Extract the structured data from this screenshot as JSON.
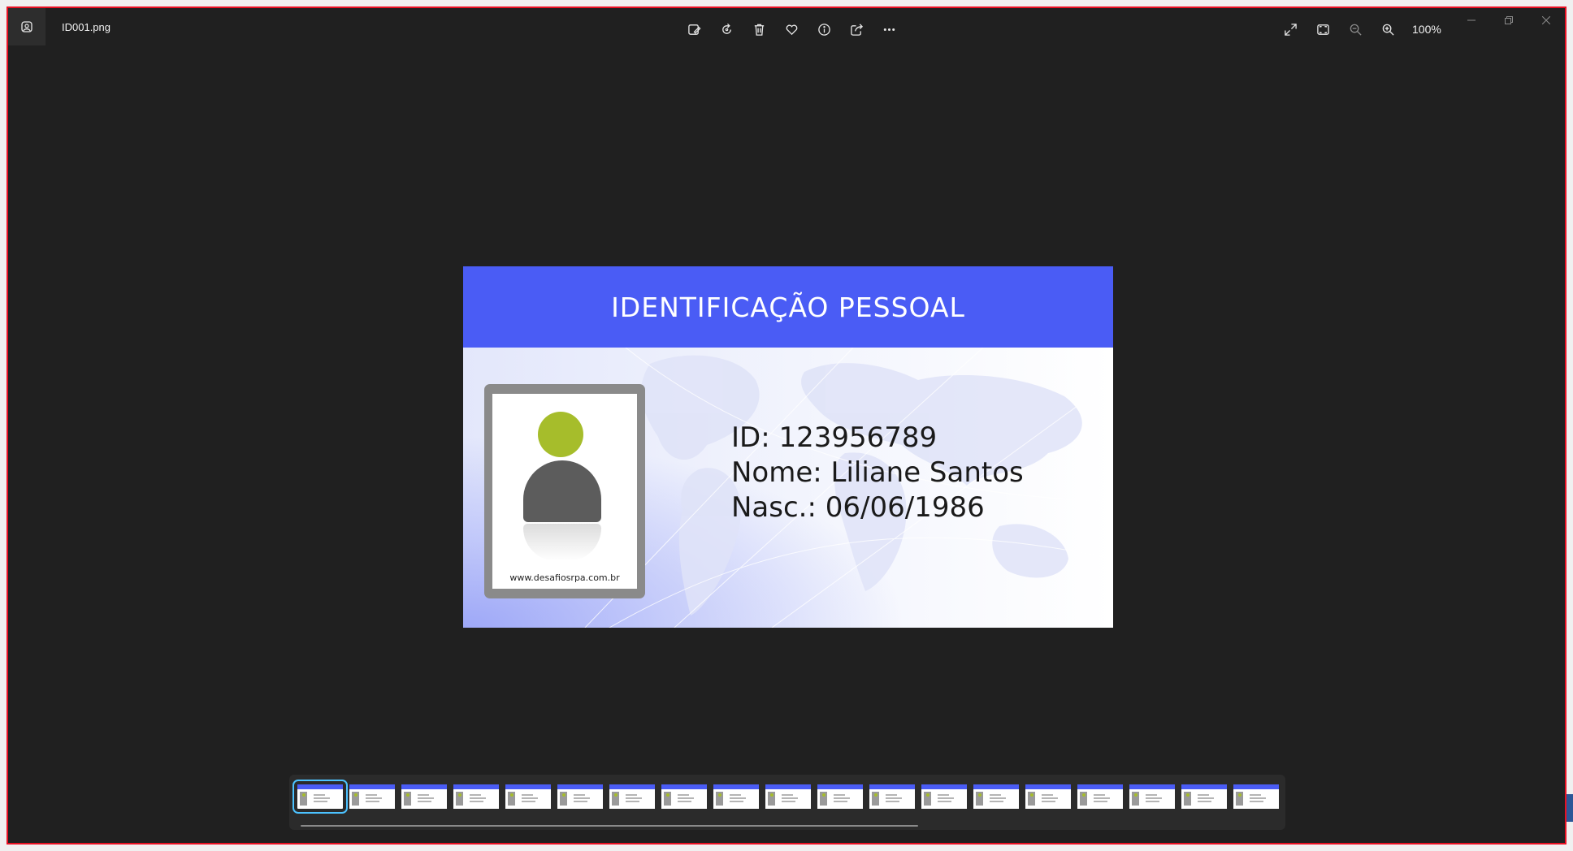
{
  "window": {
    "filename": "ID001.png",
    "zoom_label": "100%"
  },
  "toolbar": {
    "buttons": [
      {
        "icon": "edit-image-icon",
        "label": "Edit image"
      },
      {
        "icon": "rotate-icon",
        "label": "Rotate"
      },
      {
        "icon": "delete-icon",
        "label": "Delete"
      },
      {
        "icon": "favorite-icon",
        "label": "Favorite"
      },
      {
        "icon": "info-icon",
        "label": "File information"
      },
      {
        "icon": "share-icon",
        "label": "Share"
      },
      {
        "icon": "more-icon",
        "label": "See more"
      }
    ],
    "right_buttons": [
      {
        "icon": "fullscreen-icon"
      },
      {
        "icon": "fit-window-icon"
      },
      {
        "icon": "zoom-out-icon"
      },
      {
        "icon": "zoom-in-icon"
      }
    ]
  },
  "card": {
    "header_bg": "#4a5cf5",
    "title": "IDENTIFICAÇÃO PESSOAL",
    "id_line": "ID: 123956789",
    "name_line": "Nome: Liliane Santos",
    "birth_line": "Nasc.: 06/06/1986",
    "photo_caption": "www.desafiosrpa.com.br"
  },
  "filmstrip": {
    "thumbnail_count": 19,
    "selected_index": 0,
    "accent": "#4cc2ff"
  }
}
